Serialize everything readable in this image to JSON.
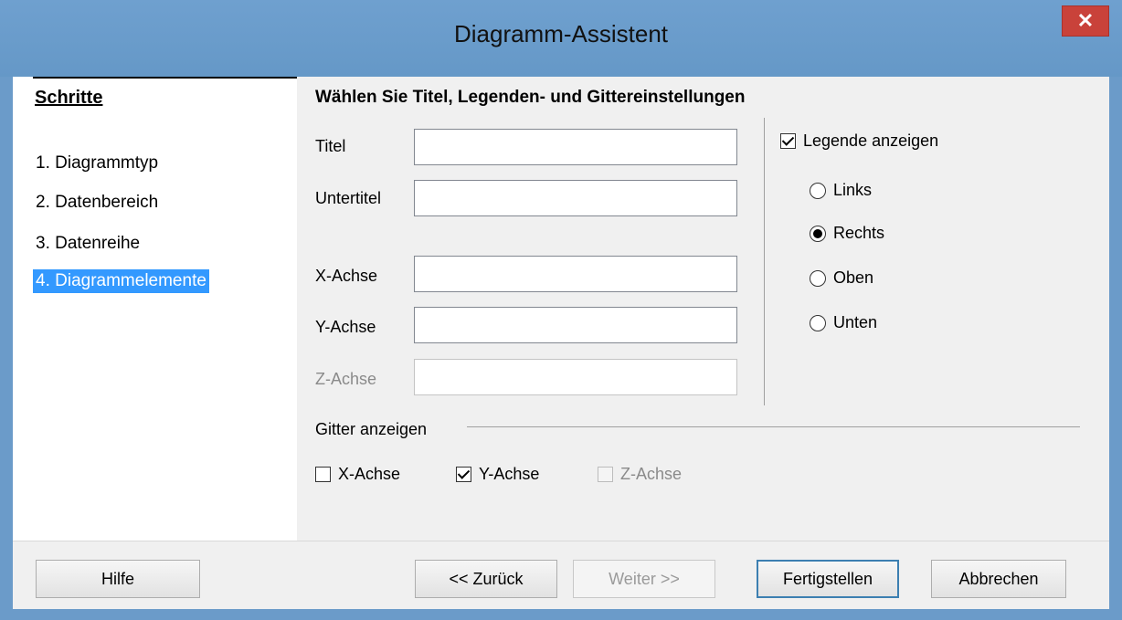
{
  "window": {
    "title": "Diagramm-Assistent",
    "close_glyph": "✕"
  },
  "steps": {
    "heading": "Schritte",
    "items": [
      {
        "label": "1. Diagrammtyp",
        "active": false
      },
      {
        "label": "2. Datenbereich",
        "active": false
      },
      {
        "label": "3. Datenreihe",
        "active": false
      },
      {
        "label": "4. Diagrammelemente",
        "active": true
      }
    ]
  },
  "content": {
    "heading": "Wählen Sie Titel, Legenden- und Gittereinstellungen",
    "fields": [
      {
        "label": "Titel",
        "value": "",
        "enabled": true
      },
      {
        "label": "Untertitel",
        "value": "",
        "enabled": true
      },
      {
        "label": "X-Achse",
        "value": "",
        "enabled": true
      },
      {
        "label": "Y-Achse",
        "value": "",
        "enabled": true
      },
      {
        "label": "Z-Achse",
        "value": "",
        "enabled": false
      }
    ],
    "legend": {
      "show_label": "Legende anzeigen",
      "show_checked": true,
      "positions": [
        {
          "label": "Links",
          "selected": false
        },
        {
          "label": "Rechts",
          "selected": true
        },
        {
          "label": "Oben",
          "selected": false
        },
        {
          "label": "Unten",
          "selected": false
        }
      ]
    },
    "grid": {
      "label": "Gitter anzeigen",
      "options": [
        {
          "label": "X-Achse",
          "checked": false,
          "enabled": true
        },
        {
          "label": "Y-Achse",
          "checked": true,
          "enabled": true
        },
        {
          "label": "Z-Achse",
          "checked": false,
          "enabled": false
        }
      ]
    }
  },
  "footer": {
    "help": "Hilfe",
    "back": "<< Zurück",
    "next": "Weiter >>",
    "finish": "Fertigstellen",
    "cancel": "Abbrechen"
  },
  "colors": {
    "titlebar": "#6b9bc9",
    "selection": "#3399ff",
    "close": "#c9423a"
  }
}
